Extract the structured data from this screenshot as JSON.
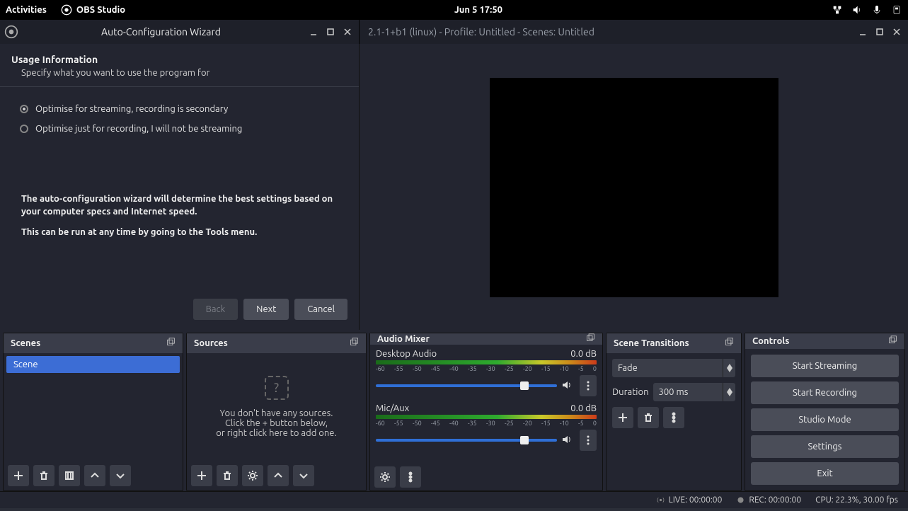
{
  "gnome": {
    "activities": "Activities",
    "app_name": "OBS Studio",
    "datetime": "Jun 5  17:50"
  },
  "wizard": {
    "window_title": "Auto-Configuration Wizard",
    "heading": "Usage Information",
    "subheading": "Specify what you want to use the program for",
    "option1": "Optimise for streaming, recording is secondary",
    "option2": "Optimise just for recording, I will not be streaming",
    "info1": "The auto-configuration wizard will determine the best settings based on your computer specs and Internet speed.",
    "info2": "This can be run at any time by going to the Tools menu.",
    "back": "Back",
    "next": "Next",
    "cancel": "Cancel"
  },
  "main_window": {
    "title": "2.1-1+b1 (linux) - Profile: Untitled - Scenes: Untitled"
  },
  "panels": {
    "scenes_title": "Scenes",
    "sources_title": "Sources",
    "mixer_title": "Audio Mixer",
    "transitions_title": "Scene Transitions",
    "controls_title": "Controls"
  },
  "scenes": {
    "items": [
      "Scene"
    ]
  },
  "sources": {
    "empty1": "You don't have any sources.",
    "empty2": "Click the + button below,",
    "empty3": "or right click here to add one."
  },
  "mixer": {
    "ch1_name": "Desktop Audio",
    "ch1_db": "0.0 dB",
    "ch2_name": "Mic/Aux",
    "ch2_db": "0.0 dB",
    "ticks": [
      "-60",
      "-55",
      "-50",
      "-45",
      "-40",
      "-35",
      "-30",
      "-25",
      "-20",
      "-15",
      "-10",
      "-5",
      "0"
    ]
  },
  "transitions": {
    "selected": "Fade",
    "duration_label": "Duration",
    "duration_value": "300 ms"
  },
  "controls": {
    "start_streaming": "Start Streaming",
    "start_recording": "Start Recording",
    "studio_mode": "Studio Mode",
    "settings": "Settings",
    "exit": "Exit"
  },
  "status": {
    "live": "LIVE: 00:00:00",
    "rec": "REC: 00:00:00",
    "cpu": "CPU: 22.3%, 30.00 fps"
  }
}
